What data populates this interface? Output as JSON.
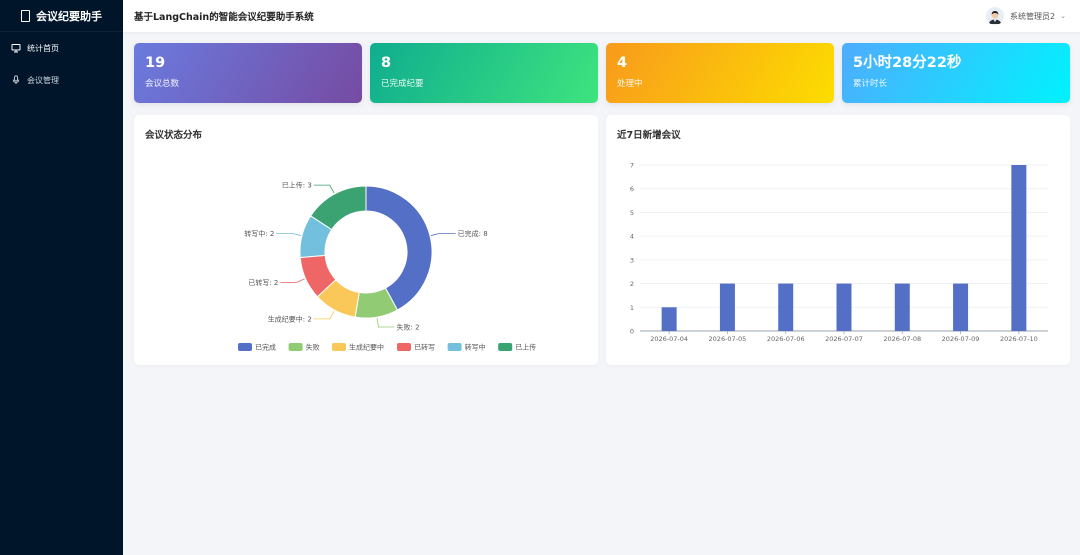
{
  "app": {
    "name": "会议纪要助手"
  },
  "sidebar": {
    "items": [
      {
        "label": "统计首页",
        "icon": "monitor-icon",
        "active": true
      },
      {
        "label": "会议管理",
        "icon": "microphone-icon",
        "active": false
      }
    ]
  },
  "header": {
    "title": "基于LangChain的智能会议纪要助手系统",
    "user": "系统管理员2"
  },
  "stats": [
    {
      "value": "19",
      "label": "会议总数"
    },
    {
      "value": "8",
      "label": "已完成纪要"
    },
    {
      "value": "4",
      "label": "处理中"
    },
    {
      "value": "5小时28分22秒",
      "label": "累计时长"
    }
  ],
  "status_chart_title": "会议状态分布",
  "daily_chart_title": "近7日新增会议",
  "chart_data": [
    {
      "type": "pie",
      "title": "会议状态分布",
      "slices": [
        {
          "name": "已完成",
          "value": 8,
          "color": "#5470c6",
          "label": "已完成: 8"
        },
        {
          "name": "失败",
          "value": 2,
          "color": "#91cc75",
          "label": "失败: 2"
        },
        {
          "name": "生成纪要中",
          "value": 2,
          "color": "#fac858",
          "label": "生成纪要中: 2"
        },
        {
          "name": "已转写",
          "value": 2,
          "color": "#ee6666",
          "label": "已转写: 2"
        },
        {
          "name": "转写中",
          "value": 2,
          "color": "#73c0de",
          "label": "转写中: 2"
        },
        {
          "name": "已上传",
          "value": 3,
          "color": "#3ba272",
          "label": "已上传: 3"
        }
      ],
      "legend_position": "bottom"
    },
    {
      "type": "bar",
      "title": "近7日新增会议",
      "categories": [
        "2026-07-04",
        "2026-07-05",
        "2026-07-06",
        "2026-07-07",
        "2026-07-08",
        "2026-07-09",
        "2026-07-10"
      ],
      "values": [
        1,
        2,
        2,
        2,
        2,
        2,
        7
      ],
      "ylim": [
        0,
        7
      ],
      "yticks": [
        "0",
        "1",
        "2",
        "3",
        "4",
        "5",
        "6",
        "7"
      ],
      "grid": true,
      "color": "#5470c6"
    }
  ]
}
